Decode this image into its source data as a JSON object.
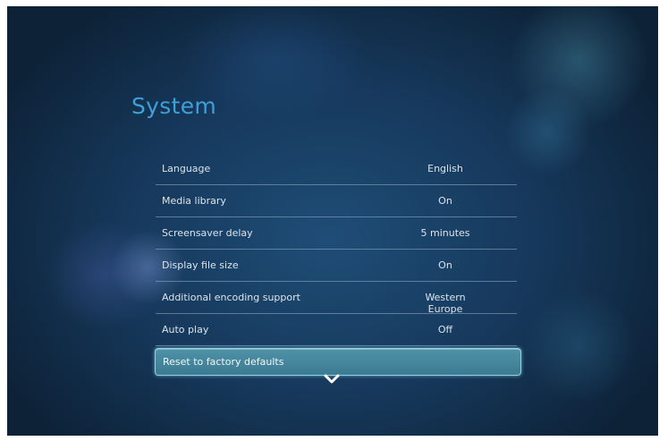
{
  "title": "System",
  "settings": [
    {
      "label": "Language",
      "value": "English"
    },
    {
      "label": "Media library",
      "value": "On"
    },
    {
      "label": "Screensaver delay",
      "value": "5 minutes"
    },
    {
      "label": "Display file size",
      "value": "On"
    },
    {
      "label": "Additional encoding support",
      "value": "Western Europe"
    },
    {
      "label": "Auto play",
      "value": "Off"
    }
  ],
  "selected_item": {
    "label": "Reset to factory defaults"
  },
  "icons": {
    "scroll_down": "chevron-down-icon"
  },
  "colors": {
    "title": "#3f9fd9",
    "background": "#16385b",
    "highlight": "#4f93a8",
    "text": "#dbe3ec"
  }
}
